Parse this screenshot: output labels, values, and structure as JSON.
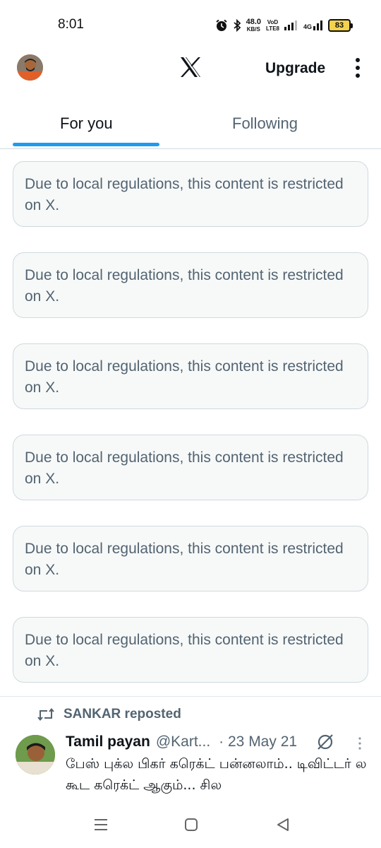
{
  "status_bar": {
    "time": "8:01",
    "net_speed": "48.0",
    "net_unit": "KB/S",
    "volte_top": "VoD",
    "volte_bottom": "LTE8",
    "network": "4G",
    "battery": "83",
    "battery_color": "#f5d24b"
  },
  "header": {
    "upgrade_label": "Upgrade",
    "logo_icon": "x-logo-icon",
    "more_icon": "more-vertical-icon"
  },
  "tabs": [
    {
      "label": "For you",
      "active": true
    },
    {
      "label": "Following",
      "active": false
    }
  ],
  "notices": [
    {
      "text": "Due to local regulations, this content is restricted on X."
    },
    {
      "text": "Due to local regulations, this content is restricted on X."
    },
    {
      "text": "Due to local regulations, this content is restricted on X."
    },
    {
      "text": "Due to local regulations, this content is restricted on X."
    },
    {
      "text": "Due to local regulations, this content is restricted on X."
    },
    {
      "text": "Due to local regulations, this content is restricted on X."
    }
  ],
  "tweet": {
    "repost_label": "SANKAR reposted",
    "name": "Tamil payan",
    "handle": "@Kart...",
    "date": "· 23 May 21",
    "text": "பேஸ் புக்ல பிகர் கரெக்ட் பன்னலாம்.. டிவிட்டர் ல கூட கரெக்ட் ஆகும்... சில"
  },
  "colors": {
    "accent": "#1d9bf0",
    "secondary_text": "#536471",
    "notice_bg": "#f7f9f9"
  }
}
